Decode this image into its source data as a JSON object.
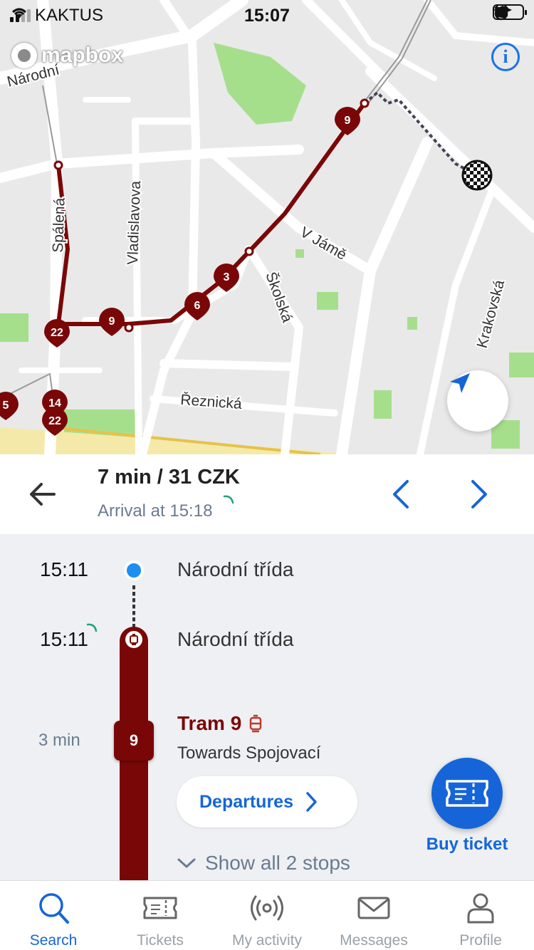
{
  "status_bar": {
    "carrier": "KAKTUS",
    "time": "15:07",
    "battery_level": 0.45
  },
  "map": {
    "attribution": "mapbox",
    "street_labels": [
      "Národní",
      "Spálená",
      "Vladislavova",
      "V Jámě",
      "Školská",
      "Krakovská",
      "Řeznická"
    ],
    "route_markers": [
      "9",
      "3",
      "6",
      "9",
      "22",
      "14",
      "22",
      "5"
    ],
    "route_color": "#7a0707"
  },
  "route": {
    "summary": "7 min / 31 CZK",
    "arrival": "Arrival at 15:18"
  },
  "itinerary": {
    "start": {
      "time": "15:11",
      "stop": "Národní třída"
    },
    "board": {
      "time": "15:11",
      "stop": "Národní třída"
    },
    "leg": {
      "line": "9",
      "duration": "3 min",
      "title": "Tram 9",
      "towards": "Towards Spojovací",
      "departures_label": "Departures",
      "show_stops_label": "Show all 2 stops"
    }
  },
  "buy_ticket_label": "Buy ticket",
  "tabs": [
    {
      "label": "Search",
      "icon": "search-icon",
      "active": true
    },
    {
      "label": "Tickets",
      "icon": "ticket-icon",
      "active": false
    },
    {
      "label": "My activity",
      "icon": "activity-icon",
      "active": false
    },
    {
      "label": "Messages",
      "icon": "envelope-icon",
      "active": false
    },
    {
      "label": "Profile",
      "icon": "person-icon",
      "active": false
    }
  ],
  "colors": {
    "accent": "#1565d8",
    "tram": "#7a0707",
    "walk_dot": "#1e8ef0"
  }
}
